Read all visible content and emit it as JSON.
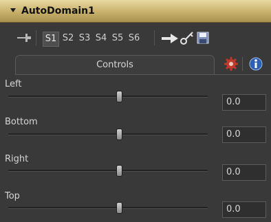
{
  "node": {
    "title": "AutoDomain1"
  },
  "toolbar": {
    "slots": [
      "S1",
      "S2",
      "S3",
      "S4",
      "S5",
      "S6"
    ],
    "active_slot": "S1"
  },
  "tabs": [
    {
      "label": "Controls",
      "active": true
    },
    {
      "icon": "gear-icon"
    },
    {
      "icon": "info-icon"
    }
  ],
  "controls": [
    {
      "label": "Left",
      "value": "0.0",
      "slider_fraction": 0.5
    },
    {
      "label": "Bottom",
      "value": "0.0",
      "slider_fraction": 0.5
    },
    {
      "label": "Right",
      "value": "0.0",
      "slider_fraction": 0.5
    },
    {
      "label": "Top",
      "value": "0.0",
      "slider_fraction": 0.5
    }
  ],
  "colors": {
    "title_bar": "#c7b06a",
    "panel": "#393939",
    "accent_gear": "#c0392b",
    "accent_info": "#2d5fb3"
  }
}
